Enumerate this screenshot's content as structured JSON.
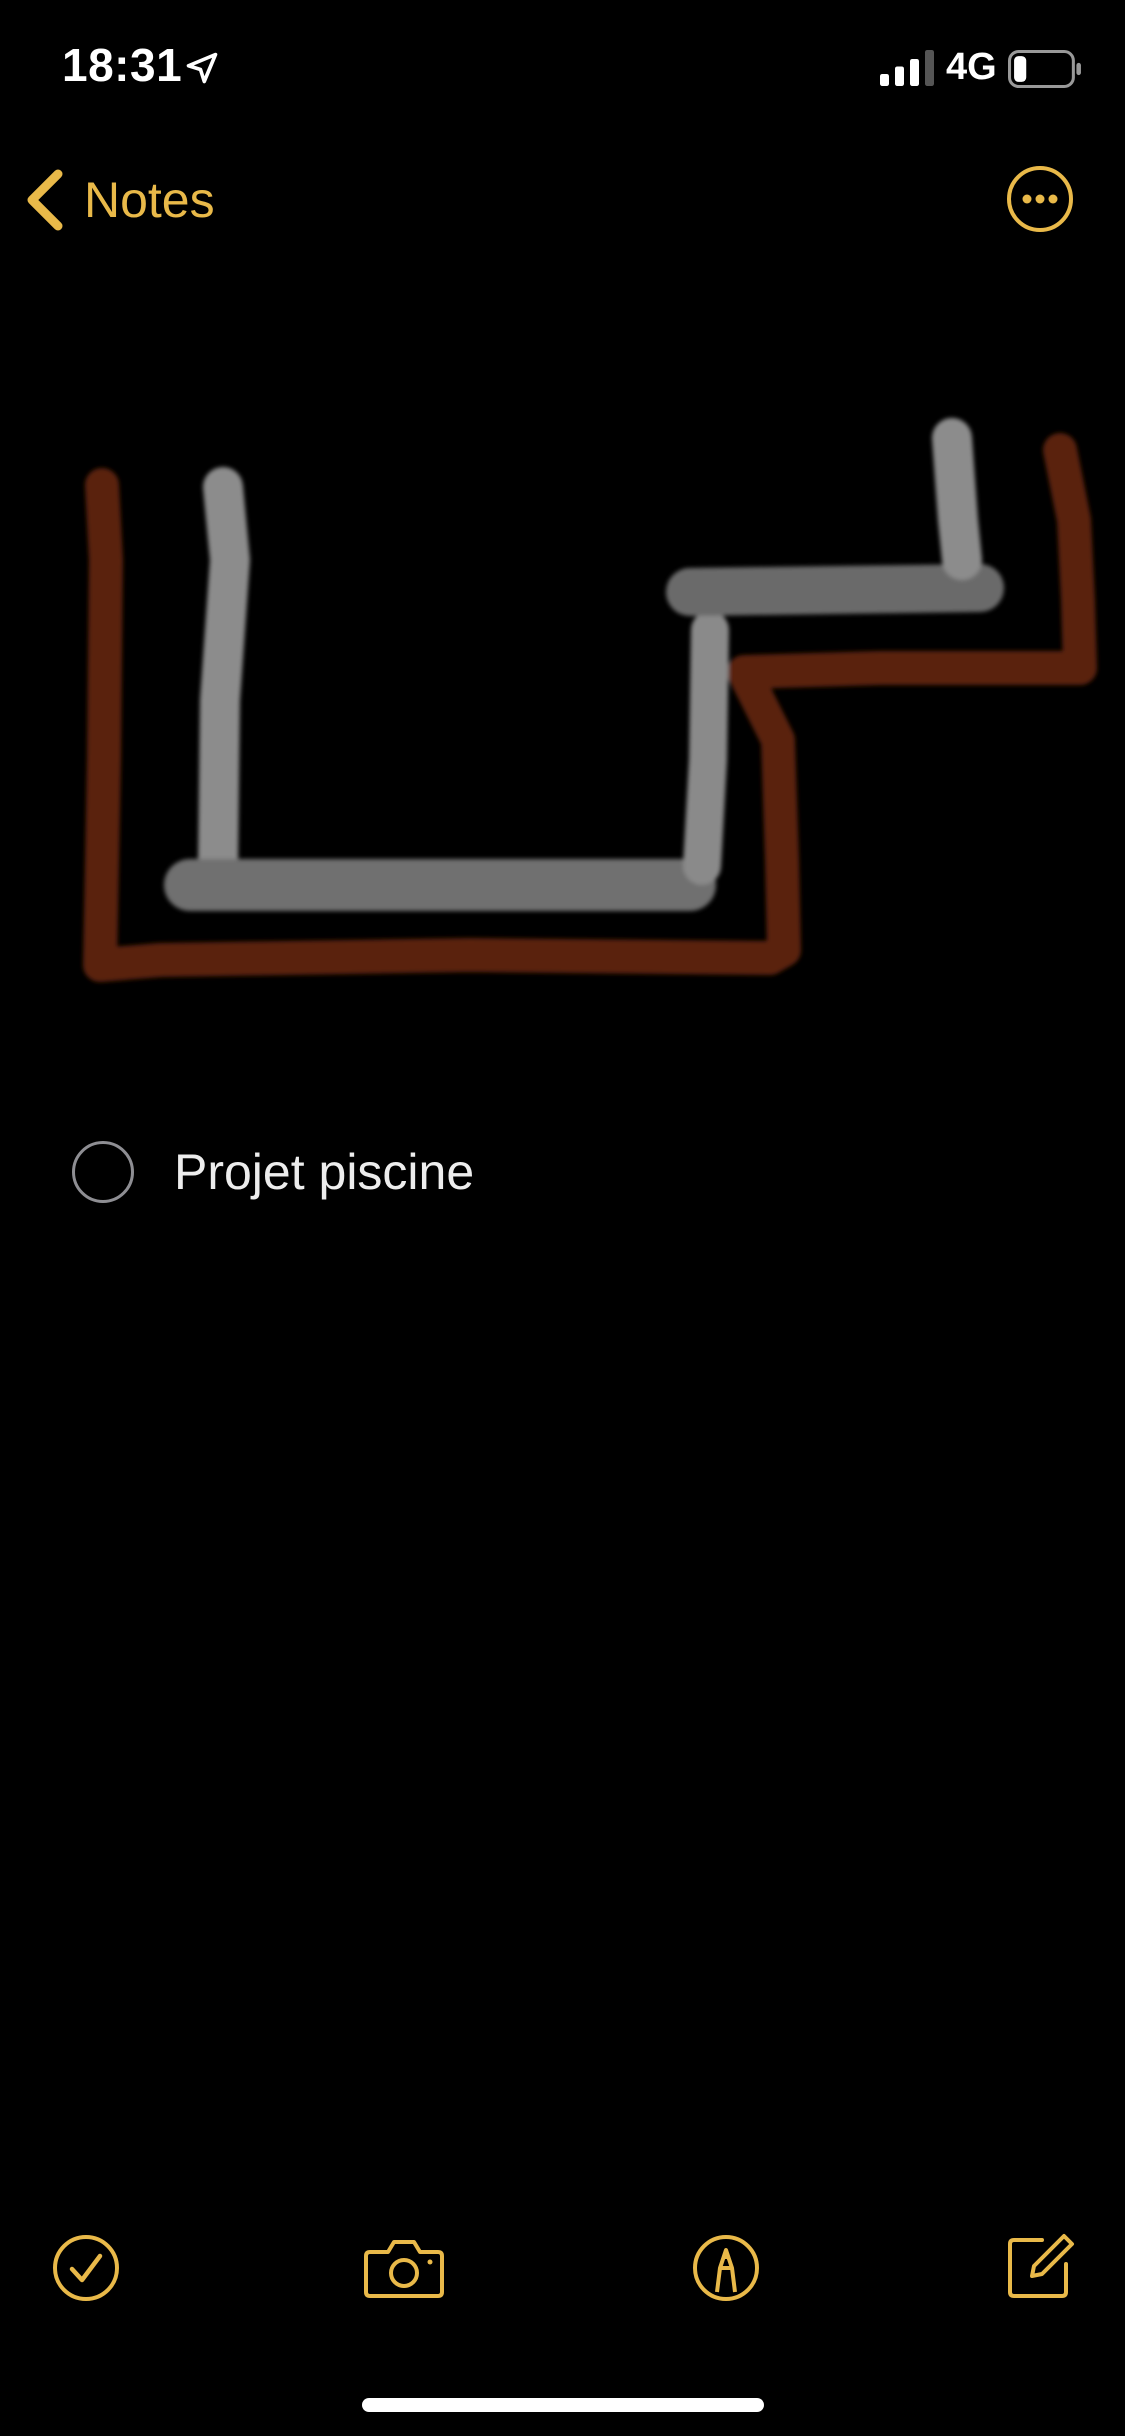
{
  "status_bar": {
    "time": "18:31",
    "network": "4G",
    "location_icon": "location-arrow-icon",
    "signal_icon": "cellular-signal-icon",
    "battery_icon": "battery-low-icon"
  },
  "nav": {
    "back_label": "Notes",
    "back_icon": "chevron-left-icon",
    "more_icon": "ellipsis-circle-icon"
  },
  "note": {
    "checklist": [
      {
        "text": "Projet piscine",
        "checked": false
      }
    ]
  },
  "toolbar": {
    "checklist_icon": "checkmark-circle-icon",
    "camera_icon": "camera-icon",
    "markup_icon": "markup-pen-icon",
    "compose_icon": "compose-icon"
  },
  "colors": {
    "accent": "#E9B949",
    "background": "#000000",
    "drawing_brown": "#5A2410",
    "drawing_gray": "#7A7A7A"
  }
}
